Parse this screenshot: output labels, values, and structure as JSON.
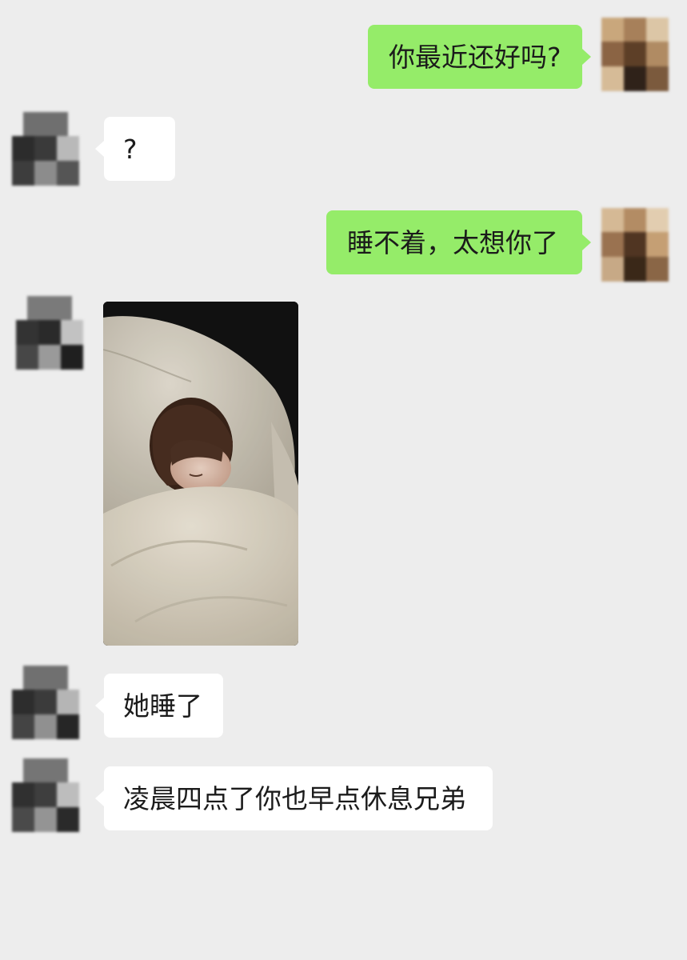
{
  "messages": [
    {
      "side": "right",
      "type": "text",
      "text": "你最近还好吗?"
    },
    {
      "side": "left",
      "type": "text",
      "text": "?"
    },
    {
      "side": "right",
      "type": "text",
      "text": "睡不着，太想你了"
    },
    {
      "side": "left",
      "type": "image",
      "image_name": "sleeping-woman-photo"
    },
    {
      "side": "left",
      "type": "text",
      "text": "她睡了"
    },
    {
      "side": "left",
      "type": "text",
      "text": "凌晨四点了你也早点休息兄弟"
    }
  ],
  "colors": {
    "background": "#ededed",
    "my_bubble": "#95ec69",
    "their_bubble": "#ffffff",
    "text": "#1b1b1b"
  },
  "icons": {
    "my_avatar": "pixelated-avatar-icon",
    "their_avatar": "pixelated-avatar-icon"
  }
}
